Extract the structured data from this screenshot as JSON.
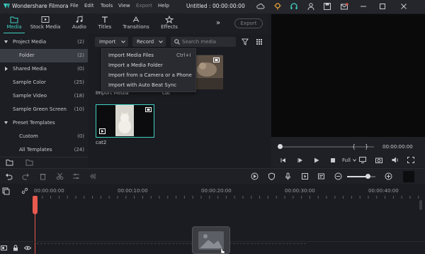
{
  "app": {
    "name": "Wondershare Filmora",
    "doc_title": "Untitled : 00:00:00:00"
  },
  "menubar": {
    "items": [
      "File",
      "Edit",
      "Tools",
      "View",
      "Export",
      "Help"
    ]
  },
  "topnav": {
    "tabs": [
      {
        "label": "Media",
        "icon": "folder-icon",
        "active": true
      },
      {
        "label": "Stock Media",
        "icon": "stock-media-icon"
      },
      {
        "label": "Audio",
        "icon": "music-icon"
      },
      {
        "label": "Titles",
        "icon": "text-icon"
      },
      {
        "label": "Transitions",
        "icon": "transitions-icon"
      },
      {
        "label": "Effects",
        "icon": "effects-icon"
      }
    ],
    "more": "»",
    "export_label": "Export"
  },
  "sidebar": {
    "items": [
      {
        "label": "Project Media",
        "count": "(2)"
      },
      {
        "label": "Folder",
        "count": "(2)"
      },
      {
        "label": "Shared Media",
        "count": "(0)"
      },
      {
        "label": "Sample Color",
        "count": "(25)"
      },
      {
        "label": "Sample Video",
        "count": "(18)"
      },
      {
        "label": "Sample Green Screen",
        "count": "(10)"
      },
      {
        "label": "Preset Templates",
        "count": ""
      },
      {
        "label": "Custom",
        "count": "(0)"
      },
      {
        "label": "All Templates",
        "count": "(24)"
      }
    ]
  },
  "media": {
    "import_label": "Import",
    "record_label": "Record",
    "search_placeholder": "Search media",
    "import_menu": [
      {
        "label": "Import Media Files",
        "shortcut": "Ctrl+I"
      },
      {
        "label": "Import a Media Folder",
        "shortcut": ""
      },
      {
        "label": "Import from a Camera or a Phone",
        "shortcut": ""
      },
      {
        "label": "Import with Auto Beat Sync",
        "shortcut": ""
      }
    ],
    "items": [
      {
        "label": "Import Media"
      },
      {
        "label": "cat"
      },
      {
        "label": "cat2"
      }
    ]
  },
  "preview": {
    "timecode": "00:00:00:00",
    "quality": "Full"
  },
  "timeline": {
    "ruler_labels": [
      "00:00:00:00",
      "00:00:10:00",
      "00:00:20:00",
      "00:00:30:00",
      "00:00:40:00"
    ]
  },
  "colors": {
    "accent": "#3fd0c2",
    "playhead": "#e85a4f"
  }
}
